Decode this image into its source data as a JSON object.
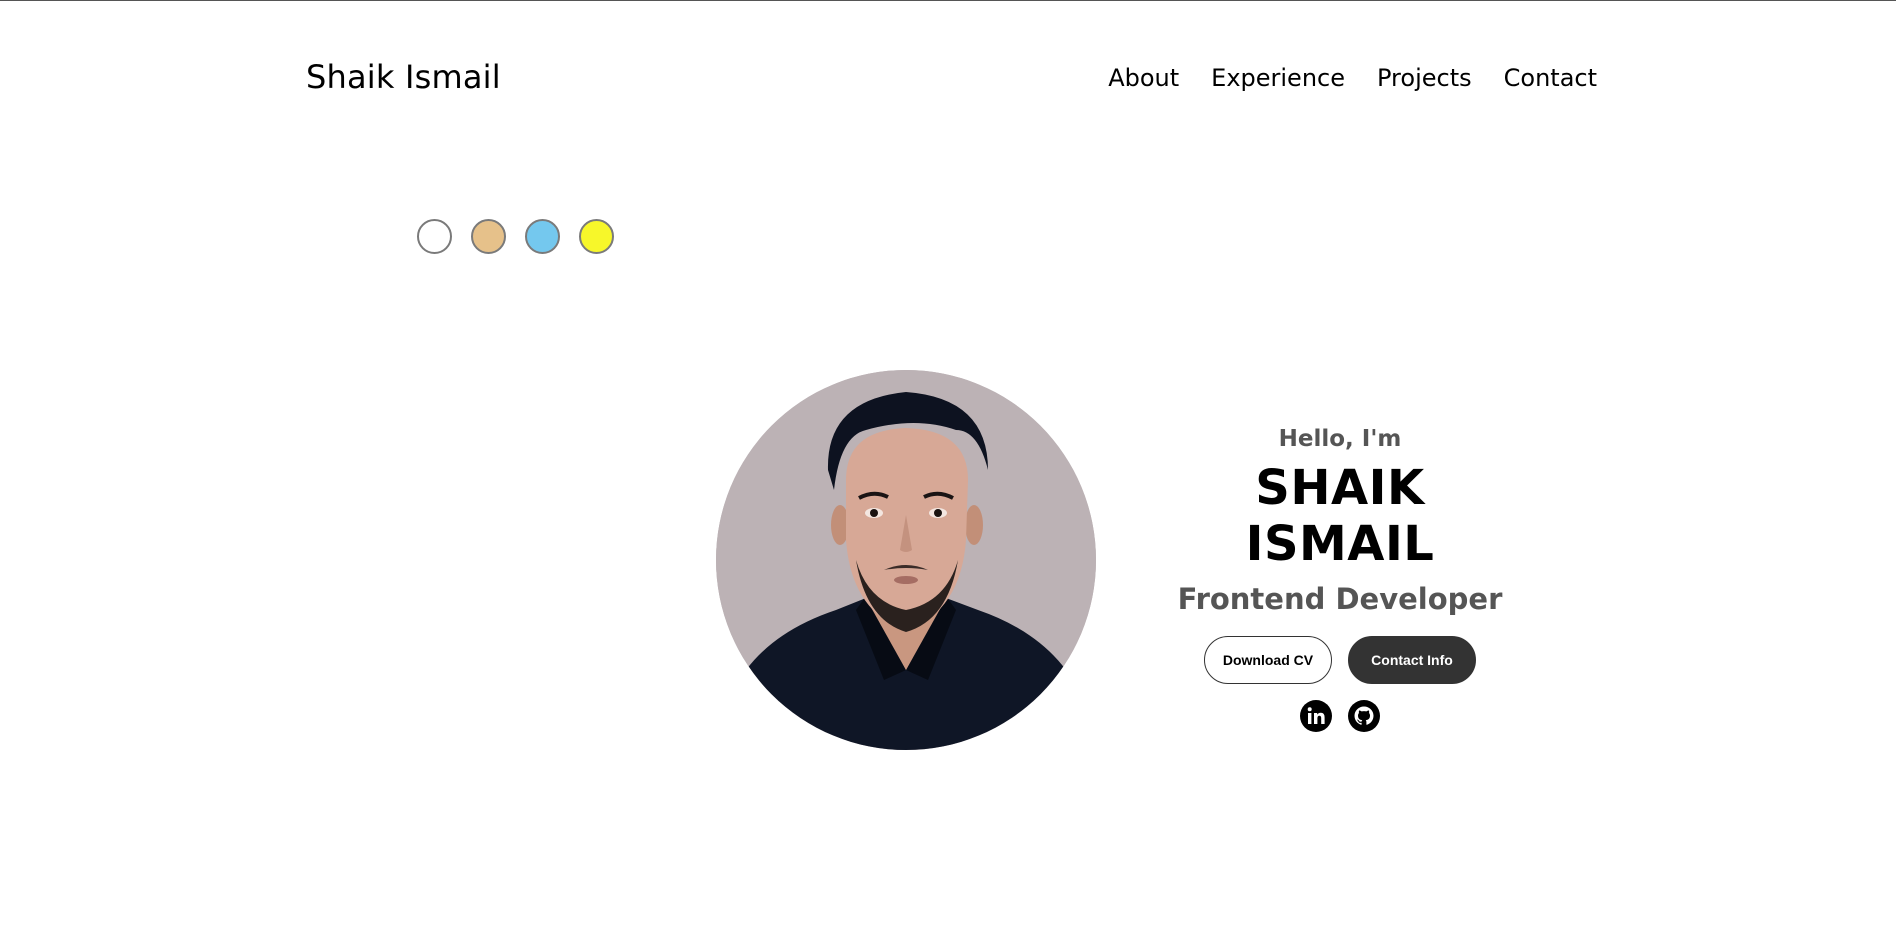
{
  "header": {
    "logo": "Shaik Ismail",
    "nav": [
      "About",
      "Experience",
      "Projects",
      "Contact"
    ]
  },
  "theme_dots": [
    {
      "color": "#ffffff"
    },
    {
      "color": "#e6c18a"
    },
    {
      "color": "#74c8ee"
    },
    {
      "color": "#f7f72a"
    }
  ],
  "hero": {
    "greeting": "Hello, I'm",
    "name": "SHAIK ISMAIL",
    "role": "Frontend Developer",
    "download_label": "Download CV",
    "contact_label": "Contact Info",
    "socials": [
      "linkedin-icon",
      "github-icon"
    ]
  }
}
